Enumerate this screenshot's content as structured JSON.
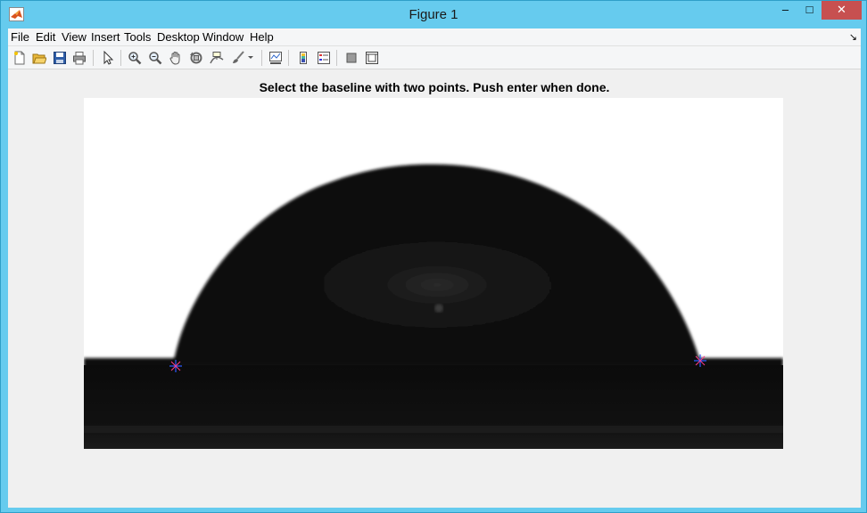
{
  "window": {
    "title": "Figure 1",
    "minimize_label": "–",
    "maximize_label": "□",
    "close_label": "✕"
  },
  "menubar": {
    "items": [
      "File",
      "Edit",
      "View",
      "Insert",
      "Tools",
      "Desktop",
      "Window",
      "Help"
    ],
    "overflow_arrow": "↘"
  },
  "toolbar": {
    "tools": [
      "new-figure-icon",
      "open-file-icon",
      "save-icon",
      "print-icon",
      "edit-plot-icon",
      "zoom-in-icon",
      "zoom-out-icon",
      "pan-icon",
      "rotate-3d-icon",
      "data-cursor-icon",
      "brush-icon",
      "link-plot-icon",
      "insert-colorbar-icon",
      "insert-legend-icon",
      "hide-plot-tools-icon",
      "show-plot-tools-icon"
    ]
  },
  "axes": {
    "title": "Select the baseline with two points. Push enter when done."
  },
  "selected_points": [
    {
      "label": "baseline-point-left"
    },
    {
      "label": "baseline-point-right"
    }
  ],
  "colors": {
    "marker_pink": "#ff3b8a",
    "marker_blue": "#2b5bff",
    "close_red": "#c75050"
  }
}
